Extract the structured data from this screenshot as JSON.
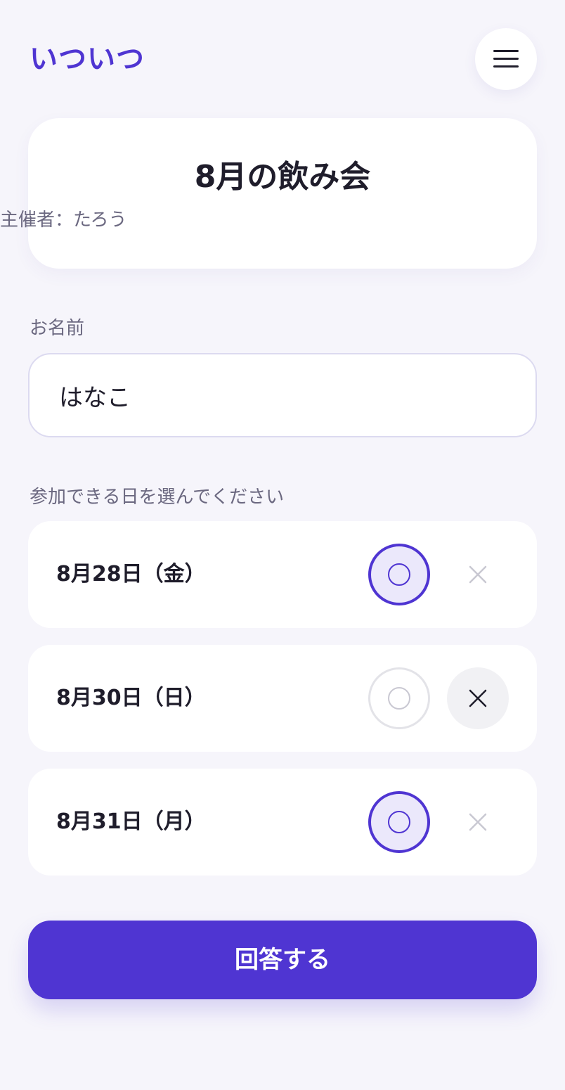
{
  "app": {
    "logo_text": "いついつ"
  },
  "header": {
    "menu_icon": "hamburger-menu-icon"
  },
  "event": {
    "title": "8月の飲み会",
    "organizer": "主催者：たろう"
  },
  "form": {
    "name_label": "お名前",
    "name_value": "はなこ",
    "dates_label": "参加できる日を選んでください",
    "dates": [
      {
        "label": "8月28日（金）",
        "answer": "yes"
      },
      {
        "label": "8月30日（日）",
        "answer": "no"
      },
      {
        "label": "8月31日（月）",
        "answer": "yes"
      }
    ],
    "yes_icon": "circle-available-icon",
    "no_icon": "cross-unavailable-icon",
    "submit_label": "回答する"
  },
  "colors": {
    "accent": "#4f35d2",
    "background": "#f6f5fb",
    "selected_yes_fill": "#ebe8fb"
  }
}
